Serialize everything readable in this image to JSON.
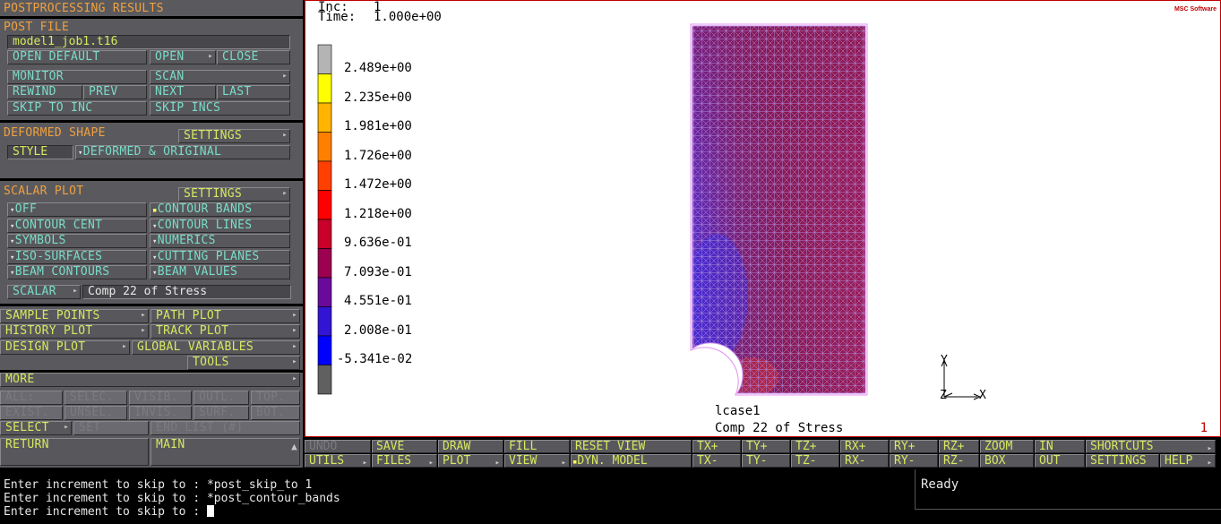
{
  "panel": {
    "title": "POSTPROCESSING RESULTS",
    "post_file": {
      "header": "POST FILE",
      "filename": "model1_job1.t16",
      "buttons": [
        "OPEN DEFAULT",
        "OPEN",
        "CLOSE",
        "MONITOR",
        "SCAN",
        "REWIND",
        "PREV",
        "NEXT",
        "LAST",
        "SKIP TO INC",
        "SKIP INCS"
      ]
    },
    "deformed": {
      "header": "DEFORMED SHAPE",
      "settings": "SETTINGS",
      "style_label": "STYLE",
      "style_value": "DEFORMED & ORIGINAL"
    },
    "scalar": {
      "header": "SCALAR PLOT",
      "settings": "SETTINGS",
      "options": [
        "OFF",
        "CONTOUR BANDS",
        "CONTOUR CENT",
        "CONTOUR LINES",
        "SYMBOLS",
        "NUMERICS",
        "ISO-SURFACES",
        "CUTTING PLANES",
        "BEAM CONTOURS",
        "BEAM VALUES"
      ],
      "selected": "CONTOUR BANDS",
      "scalar_label": "SCALAR",
      "scalar_value": "Comp 22 of Stress"
    },
    "plots": [
      "SAMPLE POINTS",
      "PATH PLOT",
      "HISTORY PLOT",
      "TRACK PLOT",
      "DESIGN PLOT",
      "GLOBAL VARIABLES",
      "TOOLS"
    ],
    "more": "MORE",
    "select_grid": [
      "ALL:",
      "SELEC.",
      "VISIB.",
      "OUTL.",
      "TOP.",
      "EXIST.",
      "UNSEL.",
      "INVIS.",
      "SURF.",
      "BOT."
    ],
    "select": "SELECT",
    "set": "SET",
    "end_list": "END LIST (#)",
    "return": "RETURN",
    "main": "MAIN"
  },
  "viewport": {
    "inc_label": "Inc:",
    "inc_value": "1",
    "time_label": "Time:",
    "time_value": "1.000e+00",
    "logo": "MSC Software",
    "legend": {
      "values": [
        "2.489e+00",
        "2.235e+00",
        "1.981e+00",
        "1.726e+00",
        "1.472e+00",
        "1.218e+00",
        "9.636e-01",
        "7.093e-01",
        "4.551e-01",
        "2.008e-01",
        "-5.341e-02"
      ],
      "colors": [
        "#b4b4b4",
        "#ffff00",
        "#ffb400",
        "#ff8000",
        "#ff4000",
        "#ff0000",
        "#c8002a",
        "#9c0050",
        "#6a0a9a",
        "#3214d4",
        "#0000ff",
        "#606060"
      ]
    },
    "loadcase": "lcase1",
    "result_name": "Comp 22 of Stress",
    "page_no": "1",
    "axes": {
      "x": "X",
      "y": "Y",
      "z": "Z"
    }
  },
  "toolbar": {
    "row1": [
      "UNDO",
      "SAVE",
      "DRAW",
      "FILL",
      "RESET VIEW",
      "TX+",
      "TY+",
      "TZ+",
      "RX+",
      "RY+",
      "RZ+",
      "ZOOM",
      "IN",
      "SHORTCUTS"
    ],
    "row2": [
      "UTILS",
      "FILES",
      "PLOT",
      "VIEW",
      "DYN. MODEL",
      "TX-",
      "TY-",
      "TZ-",
      "RX-",
      "RY-",
      "RZ-",
      "BOX",
      "OUT",
      "SETTINGS",
      "HELP"
    ]
  },
  "console": {
    "lines": [
      "Enter increment to skip to : *post_skip_to 1",
      "Enter increment to skip to : *post_contour_bands",
      "Enter increment to skip to : "
    ]
  },
  "status": {
    "text": "Ready"
  }
}
